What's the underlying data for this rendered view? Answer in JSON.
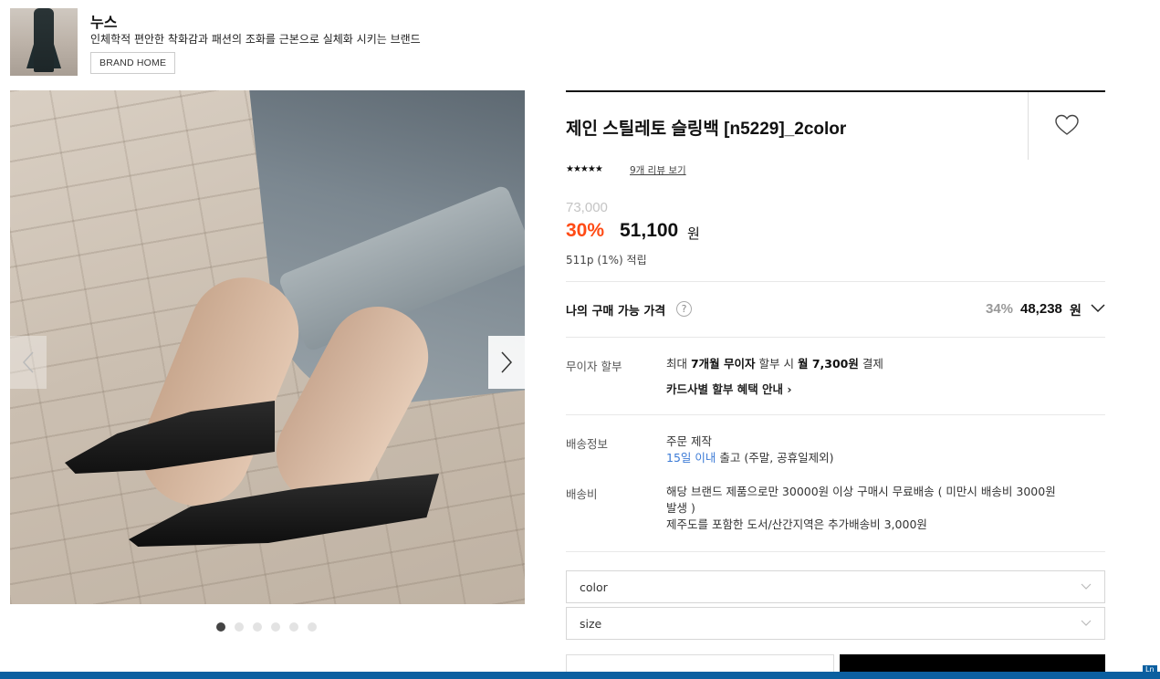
{
  "brand": {
    "name": "누스",
    "description": "인체학적 편안한 착화감과 패션의 조화를 근본으로 실체화 시키는 브랜드",
    "home_button": "BRAND HOME"
  },
  "gallery": {
    "slide_count": 6,
    "active_index": 0,
    "prev_icon": "chevron-left-icon",
    "next_icon": "chevron-right-icon"
  },
  "product": {
    "title": "제인 스틸레토 슬링백 [n5229]_2color",
    "rating_stars": "★★★★★",
    "review_link": "9개 리뷰 보기",
    "original_price": "73,000",
    "discount_rate": "30%",
    "sale_price": "51,100",
    "currency": "원",
    "points": "511p (1%) 적립"
  },
  "my_price": {
    "label": "나의 구매 가능 가격",
    "help": "?",
    "discount_rate": "34%",
    "price": "48,238",
    "currency": "원"
  },
  "installment": {
    "label": "무이자 할부",
    "text_prefix": "최대 ",
    "months": "7개월 무이자",
    "text_mid": " 할부 시 ",
    "monthly": "월 7,300원",
    "text_suffix": " 결제",
    "card_link": "카드사별 할부 혜택 안내 ›"
  },
  "shipping": {
    "label": "배송정보",
    "line1": "주문 제작",
    "days": "15일 이내",
    "line2_suffix": " 출고 (주말, 공휴일제외)"
  },
  "shipping_fee": {
    "label": "배송비",
    "line1": "해당 브랜드 제품으로만 30000원 이상 구매시 무료배송 ( 미만시 배송비 3000원",
    "line2": "발생 )",
    "line3": "제주도를 포함한 도서/산간지역은 추가배송비 3,000원"
  },
  "options": {
    "color_label": "color",
    "size_label": "size"
  },
  "footer": {
    "tag": "Ln"
  },
  "colors": {
    "discount": "#ff4b15",
    "link_blue": "#3b7ad6",
    "bottom_bar": "#0b5fa0"
  }
}
